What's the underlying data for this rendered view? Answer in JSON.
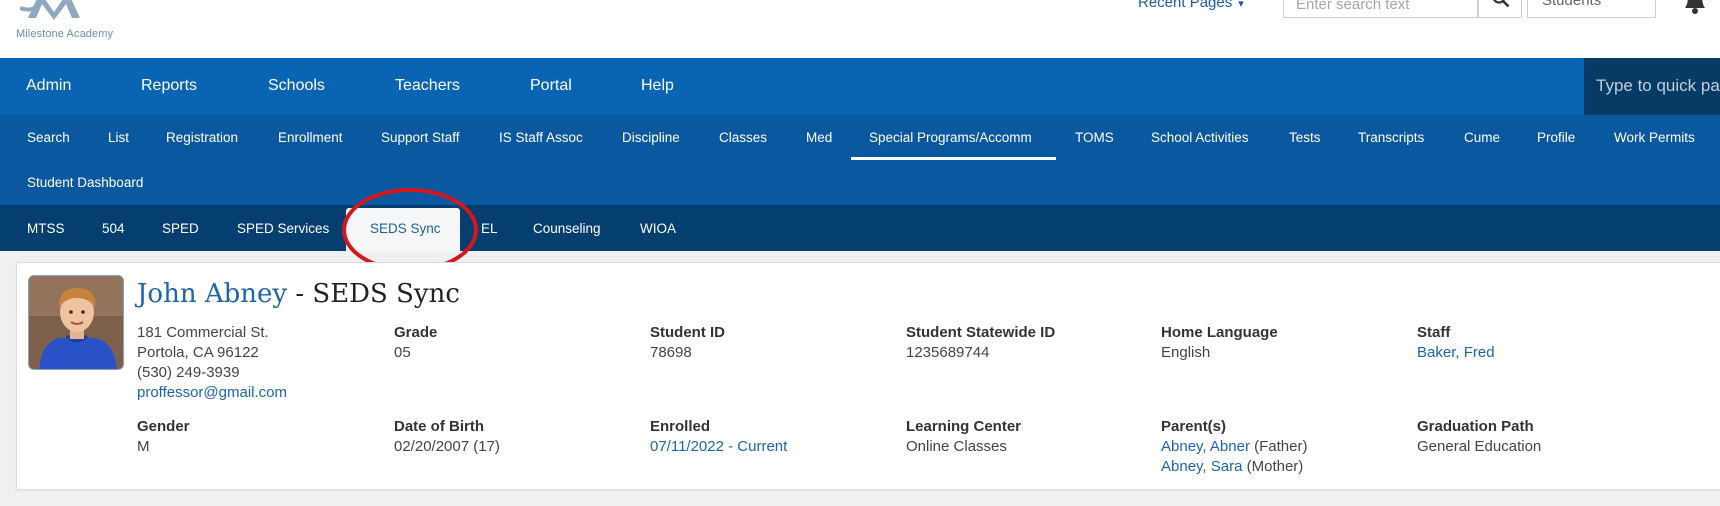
{
  "header": {
    "logo_text": "Milestone Academy",
    "recent_pages": "Recent Pages",
    "search_placeholder": "Enter search text",
    "scope": "Students"
  },
  "main_nav": {
    "items": [
      "Admin",
      "Reports",
      "Schools",
      "Teachers",
      "Portal",
      "Help"
    ],
    "quick_placeholder": "Type to quick pa"
  },
  "sub_nav": {
    "items": [
      "Search",
      "List",
      "Registration",
      "Enrollment",
      "Support Staff",
      "IS Staff Assoc",
      "Discipline",
      "Classes",
      "Med",
      "Special Programs/Accomm",
      "TOMS",
      "School Activities",
      "Tests",
      "Transcripts",
      "Cume",
      "Profile",
      "Work Permits",
      "Student Dashboard"
    ],
    "active": "Special Programs/Accomm"
  },
  "tert_nav": {
    "items": [
      "MTSS",
      "504",
      "SPED",
      "SPED Services",
      "SEDS Sync",
      "EL",
      "Counseling",
      "WIOA"
    ],
    "active": "SEDS Sync"
  },
  "student": {
    "name": "John Abney",
    "title_suffix": " - SEDS Sync",
    "address_line1": "181 Commercial St.",
    "address_line2": "Portola, CA 96122",
    "phone": "(530) 249-3939",
    "email": "proffessor@gmail.com",
    "grade_label": "Grade",
    "grade": "05",
    "student_id_label": "Student ID",
    "student_id": "78698",
    "statewide_id_label": "Student Statewide ID",
    "statewide_id": "1235689744",
    "home_language_label": "Home Language",
    "home_language": "English",
    "staff_label": "Staff",
    "staff": "Baker, Fred",
    "gender_label": "Gender",
    "gender": "M",
    "dob_label": "Date of Birth",
    "dob": "02/20/2007 (17)",
    "enrolled_label": "Enrolled",
    "enrolled": "07/11/2022 - Current",
    "learning_center_label": "Learning Center",
    "learning_center": "Online Classes",
    "parents_label": "Parent(s)",
    "parent1_name": "Abney, Abner",
    "parent1_rel": "(Father)",
    "parent2_name": "Abney, Sara",
    "parent2_rel": "(Mother)",
    "graduation_label": "Graduation Path",
    "graduation": "General Education"
  },
  "colors": {
    "main_nav": "#0964b4",
    "sub_nav": "#0a58a0",
    "tert_nav": "#053f70",
    "link": "#1b65ab",
    "highlight": "#d9151c"
  }
}
